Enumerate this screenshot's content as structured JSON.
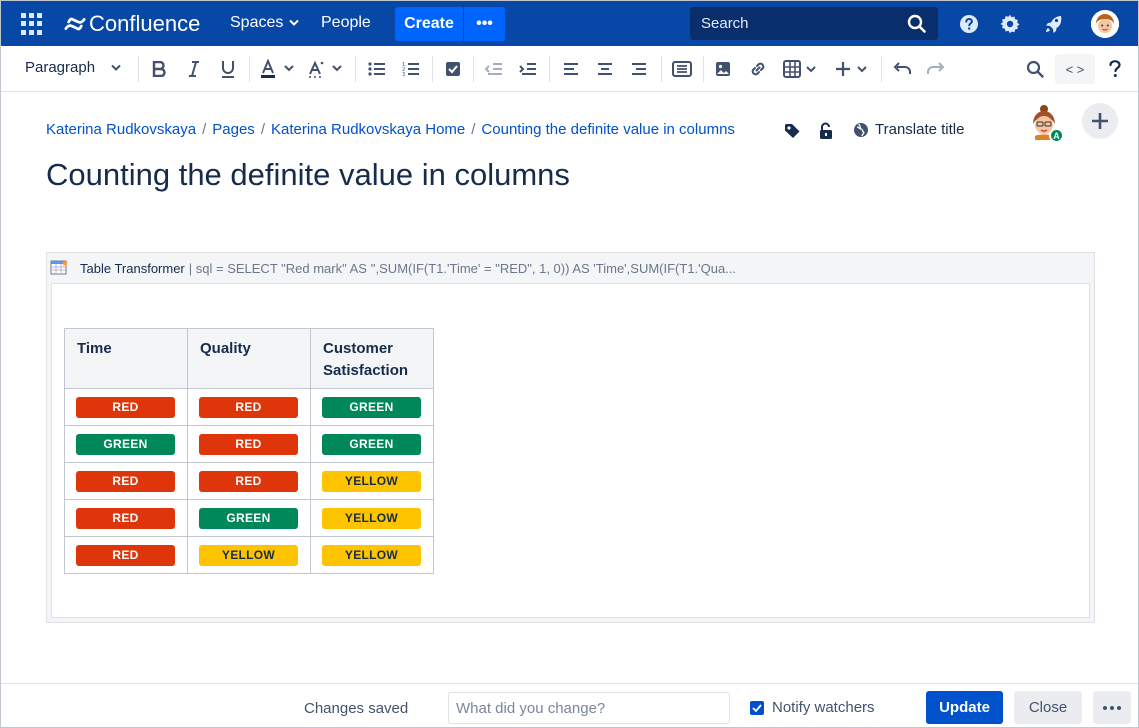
{
  "topnav": {
    "product_name": "Confluence",
    "spaces_label": "Spaces",
    "people_label": "People",
    "create_label": "Create",
    "search_placeholder": "Search",
    "brand_color": "#0747a6",
    "accent_color": "#0065ff"
  },
  "toolbar": {
    "paragraph_style": "Paragraph",
    "source_label": "< >"
  },
  "breadcrumb": {
    "items": [
      "Katerina Rudkovskaya",
      "Pages",
      "Katerina Rudkovskaya Home",
      "Counting the definite value in columns"
    ],
    "separator": "/"
  },
  "page_actions": {
    "translate_label": "Translate title",
    "collaborator_badge": "A"
  },
  "page": {
    "title": "Counting the definite value in columns"
  },
  "macro": {
    "name": "Table Transformer",
    "params": "| sql = SELECT \"Red mark\" AS '',SUM(IF(T1.'Time' = \"RED\", 1, 0)) AS 'Time',SUM(IF(T1.'Qua..."
  },
  "table": {
    "headers": [
      "Time",
      "Quality",
      "Customer Satisfaction"
    ],
    "rows": [
      [
        {
          "label": "RED",
          "color": "red"
        },
        {
          "label": "RED",
          "color": "red"
        },
        {
          "label": "GREEN",
          "color": "green"
        }
      ],
      [
        {
          "label": "GREEN",
          "color": "green"
        },
        {
          "label": "RED",
          "color": "red"
        },
        {
          "label": "GREEN",
          "color": "green"
        }
      ],
      [
        {
          "label": "RED",
          "color": "red"
        },
        {
          "label": "RED",
          "color": "red"
        },
        {
          "label": "YELLOW",
          "color": "yellow"
        }
      ],
      [
        {
          "label": "RED",
          "color": "red"
        },
        {
          "label": "GREEN",
          "color": "green"
        },
        {
          "label": "YELLOW",
          "color": "yellow"
        }
      ],
      [
        {
          "label": "RED",
          "color": "red"
        },
        {
          "label": "YELLOW",
          "color": "yellow"
        },
        {
          "label": "YELLOW",
          "color": "yellow"
        }
      ]
    ],
    "status_colors": {
      "red": "#de350b",
      "green": "#00875a",
      "yellow": "#ffc400"
    }
  },
  "footer": {
    "status_text": "Changes saved",
    "change_placeholder": "What did you change?",
    "notify_label": "Notify watchers",
    "notify_checked": true,
    "update_label": "Update",
    "close_label": "Close"
  }
}
